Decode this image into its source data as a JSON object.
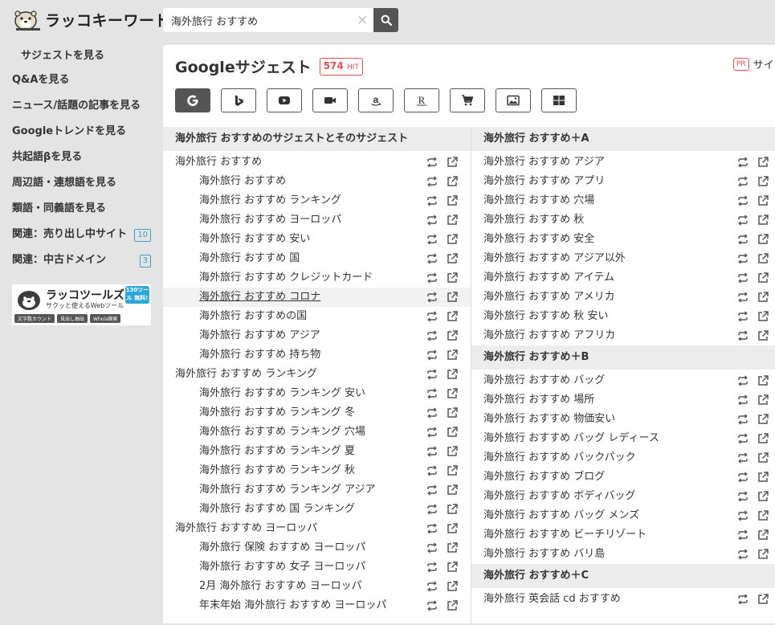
{
  "header": {
    "logo_text": "ラッコキーワード",
    "search_value": "海外旅行 おすすめ",
    "clear_label": "×"
  },
  "sidebar": {
    "items": [
      {
        "label": "サジェストを見る"
      },
      {
        "label": "Q&Aを見る"
      },
      {
        "label": "ニュース/話題の記事を見る"
      },
      {
        "label": "Googleトレンドを見る"
      },
      {
        "label": "共起語βを見る"
      },
      {
        "label": "周辺語・連想語を見る"
      },
      {
        "label": "類語・同義語を見る"
      },
      {
        "label": "関連：売り出し中サイト",
        "badge": "10"
      },
      {
        "label": "関連：中古ドメイン",
        "badge": "3"
      }
    ],
    "banner": {
      "title": "ラッコツールズ",
      "subtitle": "サクッと使えるWebツール",
      "tag": "130ツール 無料!",
      "pills": [
        "文字数カウント",
        "見出し抽出",
        "Whois検索"
      ]
    }
  },
  "main": {
    "title": "Googleサジェスト",
    "hit_count": "574",
    "hit_label": "HIT",
    "pr_badge": "PR",
    "pr_text": "サイ",
    "tabs": [
      {
        "icon": "google-icon"
      },
      {
        "icon": "bing-icon"
      },
      {
        "icon": "youtube-icon"
      },
      {
        "icon": "video-icon"
      },
      {
        "icon": "amazon-icon"
      },
      {
        "icon": "rakuten-icon"
      },
      {
        "icon": "cart-icon"
      },
      {
        "icon": "image-icon"
      },
      {
        "icon": "grid-icon"
      }
    ]
  },
  "left_column": {
    "heading": "海外旅行 おすすめのサジェストとそのサジェスト",
    "rows": [
      {
        "text": "海外旅行 おすすめ",
        "level": 0
      },
      {
        "text": "海外旅行 おすすめ",
        "level": 1
      },
      {
        "text": "海外旅行 おすすめ ランキング",
        "level": 1
      },
      {
        "text": "海外旅行 おすすめ ヨーロッパ",
        "level": 1
      },
      {
        "text": "海外旅行 おすすめ 安い",
        "level": 1
      },
      {
        "text": "海外旅行 おすすめ 国",
        "level": 1
      },
      {
        "text": "海外旅行 おすすめ クレジットカード",
        "level": 1
      },
      {
        "text": "海外旅行 おすすめ コロナ",
        "level": 1,
        "hover": true
      },
      {
        "text": "海外旅行 おすすめの国",
        "level": 1
      },
      {
        "text": "海外旅行 おすすめ アジア",
        "level": 1
      },
      {
        "text": "海外旅行 おすすめ 持ち物",
        "level": 1
      },
      {
        "text": "海外旅行 おすすめ ランキング",
        "level": 0
      },
      {
        "text": "海外旅行 おすすめ ランキング 安い",
        "level": 1
      },
      {
        "text": "海外旅行 おすすめ ランキング 冬",
        "level": 1
      },
      {
        "text": "海外旅行 おすすめ ランキング 穴場",
        "level": 1
      },
      {
        "text": "海外旅行 おすすめ ランキング 夏",
        "level": 1
      },
      {
        "text": "海外旅行 おすすめ ランキング 秋",
        "level": 1
      },
      {
        "text": "海外旅行 おすすめ ランキング アジア",
        "level": 1
      },
      {
        "text": "海外旅行 おすすめ 国 ランキング",
        "level": 1
      },
      {
        "text": "海外旅行 おすすめ ヨーロッパ",
        "level": 0
      },
      {
        "text": "海外旅行 保険 おすすめ ヨーロッパ",
        "level": 1
      },
      {
        "text": "海外旅行 おすすめ 女子 ヨーロッパ",
        "level": 1
      },
      {
        "text": "2月 海外旅行 おすすめ ヨーロッパ",
        "level": 1
      },
      {
        "text": "年末年始 海外旅行 おすすめ ヨーロッパ",
        "level": 1
      }
    ]
  },
  "right_column": {
    "groups": [
      {
        "heading": "海外旅行 おすすめ＋A",
        "rows": [
          "海外旅行 おすすめ アジア",
          "海外旅行 おすすめ アプリ",
          "海外旅行 おすすめ 穴場",
          "海外旅行 おすすめ 秋",
          "海外旅行 おすすめ 安全",
          "海外旅行 おすすめ アジア以外",
          "海外旅行 おすすめ アイテム",
          "海外旅行 おすすめ アメリカ",
          "海外旅行 おすすめ 秋 安い",
          "海外旅行 おすすめ アフリカ"
        ]
      },
      {
        "heading": "海外旅行 おすすめ＋B",
        "rows": [
          "海外旅行 おすすめ バッグ",
          "海外旅行 おすすめ 場所",
          "海外旅行 おすすめ 物価安い",
          "海外旅行 おすすめ バッグ レディース",
          "海外旅行 おすすめ バックパック",
          "海外旅行 おすすめ ブログ",
          "海外旅行 おすすめ ボディバッグ",
          "海外旅行 おすすめ バッグ メンズ",
          "海外旅行 おすすめ ビーチリゾート",
          "海外旅行 おすすめ バリ島"
        ]
      },
      {
        "heading": "海外旅行 おすすめ＋C",
        "rows": [
          "海外旅行 英会話 cd おすすめ"
        ]
      }
    ]
  },
  "colors": {
    "accent_red": "#e05050",
    "dark": "#555555",
    "badge_blue": "#3aa0c8"
  }
}
